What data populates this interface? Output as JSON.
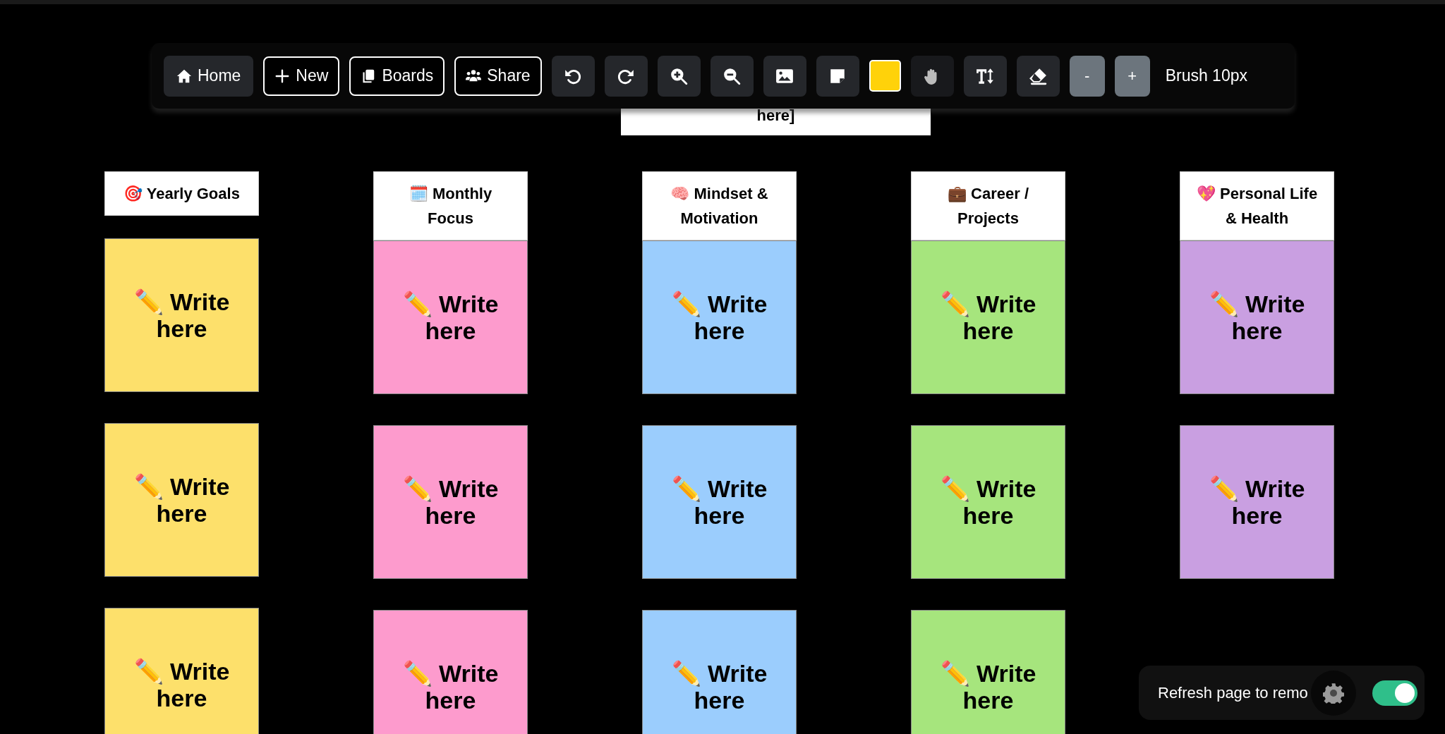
{
  "toolbar": {
    "items": [
      {
        "kind": "filled",
        "label": "Home"
      },
      {
        "kind": "outline",
        "label": "New"
      },
      {
        "kind": "outline",
        "label": "Boards"
      },
      {
        "kind": "outline",
        "label": "Share"
      },
      {
        "kind": "icon"
      },
      {
        "kind": "icon"
      },
      {
        "kind": "icon"
      },
      {
        "kind": "icon"
      },
      {
        "kind": "icon"
      },
      {
        "kind": "icon"
      },
      {
        "kind": "swatch",
        "color": "#ffd20a"
      },
      {
        "kind": "icon"
      },
      {
        "kind": "icon"
      },
      {
        "kind": "icon"
      },
      {
        "kind": "step",
        "label": "-"
      },
      {
        "kind": "step",
        "label": "+"
      },
      {
        "kind": "text",
        "label": "Brush 10px"
      }
    ]
  },
  "text_card": {
    "text": "here]"
  },
  "columns": [
    {
      "header": "🎯 Yearly Goals",
      "color": "#fde06b",
      "notes": [
        "✏️ Write here",
        "✏️ Write here",
        "✏️ Write here"
      ]
    },
    {
      "header": "🗓️ Monthly Focus",
      "color": "#fd9bcd",
      "notes": [
        "✏️ Write here",
        "✏️ Write here",
        "✏️ Write here"
      ]
    },
    {
      "header": "🧠 Mindset & Motivation",
      "color": "#9bcdfd",
      "notes": [
        "✏️ Write here",
        "✏️ Write here",
        "✏️ Write here"
      ]
    },
    {
      "header": "💼 Career / Projects",
      "color": "#a6e57d",
      "notes": [
        "✏️ Write here",
        "✏️ Write here",
        "✏️ Write here"
      ]
    },
    {
      "header": "💖 Personal Life & Health",
      "color": "#c99fe1",
      "notes": [
        "✏️ Write here",
        "✏️ Write here"
      ]
    }
  ],
  "ad_bar": {
    "text": "Refresh page to remo",
    "toggle_on": true
  }
}
